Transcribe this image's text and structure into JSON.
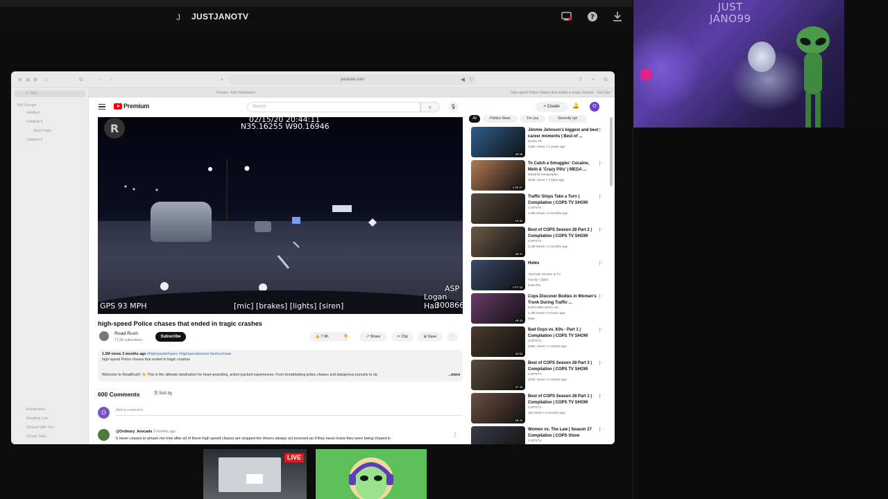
{
  "topbar": {
    "channel_initial": "J",
    "channel_name": "JUSTJANOTV"
  },
  "webcam": {
    "sign_line1": "JUST",
    "sign_line2": "JANO99"
  },
  "browser": {
    "url": "youtube.com",
    "tabs": [
      "Stream - Kick Dashboard",
      "high-speed Police chases that ended in tragic crashes - YouTube"
    ],
    "sidebar": {
      "tabs_label": "2 Tabs",
      "groups_label": "Tab Groups",
      "items": [
        "Untitled",
        "Untitled 4",
        "Start Page",
        "Untitled 3"
      ],
      "bottom": [
        "Bookmarks",
        "Reading List",
        "Shared with You",
        "iCloud Tabs"
      ]
    }
  },
  "youtube": {
    "brand": "Premium",
    "search_placeholder": "Search",
    "create_label": "Create",
    "user_initial": "O",
    "video": {
      "overlay_datetime": "02/15/20 20:44:11",
      "overlay_coords": "N35.16255 W90.16946",
      "overlay_speed": "GPS 93 MPH",
      "overlay_captions": "[mic] [brakes] [lights] [siren]",
      "overlay_agency": "ASP",
      "overlay_officer": "Logan Hall",
      "overlay_id": "300866"
    },
    "title": "high-speed Police chases that ended in tragic crashes",
    "channel": {
      "name": "Road Rush",
      "subs": "71.9K subscribers",
      "subscribe": "Subscribe"
    },
    "actions": {
      "likes": "7.9K",
      "share": "Share",
      "clip": "Clip",
      "save": "Save"
    },
    "description": {
      "views": "1.2M views",
      "ago": "3 months ago",
      "tags": "#highspeedchases #highspeedpursuit #policechase",
      "line1": "high-speed Police chases that ended in tragic crashes",
      "line2": "Welcome to RoadRush! 👋 This is the ultimate destination for heart-pounding, action-packed experiences. From breathtaking police chases and dangerous pursuits to da",
      "more": "...more"
    },
    "comments": {
      "count": "600 Comments",
      "sort": "Sort by",
      "add_placeholder": "Add a comment...",
      "first": {
        "user": "@Ordinary_Avocado",
        "ago": "3 months ago",
        "text": "It never ceases to amaze me how after all of these high speed chases are stopped the drivers always act innocent as if they never knew they were being chased in"
      }
    },
    "chips": [
      "All",
      "Politics News",
      "For you",
      "Recently upl"
    ],
    "related": [
      {
        "title": "Jimmie Johnson's biggest and best career moments | Best of ...",
        "channel": "NASCAR",
        "views": "218K views • 4 years ago",
        "duration": "39:26",
        "thumb": "#2f5d8a"
      },
      {
        "title": "To Catch a Smuggler: Cocaine, Meth & 'Crazy Pills' | MEGA ...",
        "channel": "National Geographic",
        "views": "324K views • 7 days ago",
        "duration": "3:40:27",
        "thumb": "#b07a52"
      },
      {
        "title": "Traffic Stops Take a Turn | Compilation | COPS TV SHOW",
        "channel": "COPSTV",
        "views": "1.8M views • 6 months ago",
        "duration": "44:32",
        "thumb": "#5a4a3a"
      },
      {
        "title": "Best of COPS Season 28 Part 2 | Compilation | COPS TV SHOW",
        "channel": "COPSTV",
        "views": "2.2M views • 3 months ago",
        "duration": "38:47",
        "thumb": "#6a5a44"
      },
      {
        "title": "Holes",
        "channel": "YouTube Movies & TV",
        "views": "Family • 2003",
        "duration": "1:57:22",
        "thumb": "#3a4a6a",
        "badge": "Free  PG"
      },
      {
        "title": "Cops Discover Bodies in Woman's Trunk During Traffic ...",
        "channel": "EXPLORE WITH US",
        "views": "1.3M views • 9 hours ago",
        "duration": "49:42",
        "thumb": "#6a3a6a",
        "badge": "New"
      },
      {
        "title": "Bad Guys vs. K9s - Part 1 | Compilation | COPS TV SHOW",
        "channel": "COPSTV",
        "views": "206K views • 2 weeks ago",
        "duration": "42:03",
        "thumb": "#4a3a2a"
      },
      {
        "title": "Best of COPS Season 28 Part 3 | Compilation | COPS TV SHOW",
        "channel": "COPSTV",
        "views": "233K views • 4 weeks ago",
        "duration": "37:43",
        "thumb": "#5a4a3a"
      },
      {
        "title": "Best of COPS Season 28 Part 1 | Compilation | COPS TV SHOW",
        "channel": "COPSTV",
        "views": "1M views • 3 months ago",
        "duration": "45:42",
        "thumb": "#6a5040"
      },
      {
        "title": "Women vs. The Law | Season 27 Compilation | COPS Show",
        "channel": "COPSTV",
        "views": "",
        "duration": "",
        "thumb": "#3a3a4a"
      }
    ]
  },
  "previews": {
    "live_label": "LIVE"
  }
}
